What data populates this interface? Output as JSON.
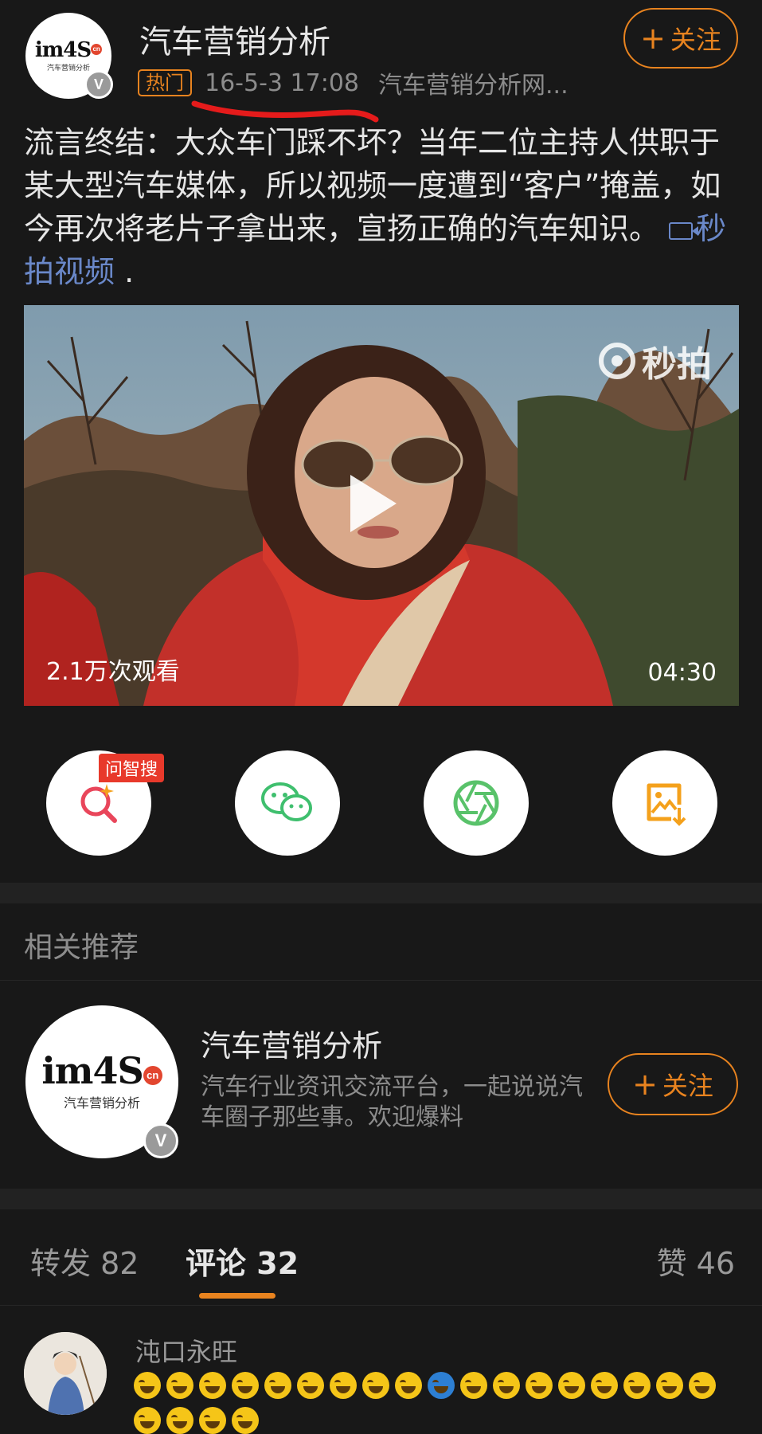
{
  "post": {
    "author": "汽车营销分析",
    "hot_badge": "热门",
    "timestamp": "16-5-3 17:08",
    "source": "汽车营销分析网...",
    "follow_label": "关注",
    "text": "流言终结：大众车门踩不坏？当年二位主持人供职于某大型汽车媒体，所以视频一度遭到“客户”掩盖，如今再次将老片子拿出来，宣扬正确的汽车知识。",
    "video_link": "秒拍视频",
    "trailing": " ."
  },
  "avatar_logo": {
    "main": "im4S",
    "cn": "cn",
    "sub": "汽车营销分析",
    "verified": "V"
  },
  "video": {
    "watermark": "秒拍",
    "views": "2.1万次观看",
    "duration": "04:30"
  },
  "share": {
    "ask_tag": "问智搜",
    "icons": [
      "search-sparkle-icon",
      "wechat-icon",
      "moments-shutter-icon",
      "save-image-icon"
    ],
    "colors": {
      "search": "#e9465b",
      "wechat": "#3fbf6e",
      "moments": "#59c26a",
      "save": "#f4a11c"
    }
  },
  "related": {
    "title": "相关推荐",
    "name": "汽车营销分析",
    "desc": "汽车行业资讯交流平台，一起说说汽车圈子那些事。欢迎爆料",
    "follow_label": "关注"
  },
  "tabs": {
    "repost": "转发 82",
    "comment": "评论 32",
    "like": "赞 46"
  },
  "comment": {
    "username": "沌口永旺"
  },
  "colors": {
    "accent": "#e8831f",
    "bg": "#181818",
    "link": "#6a88c9",
    "annotation": "#e51b1b"
  }
}
